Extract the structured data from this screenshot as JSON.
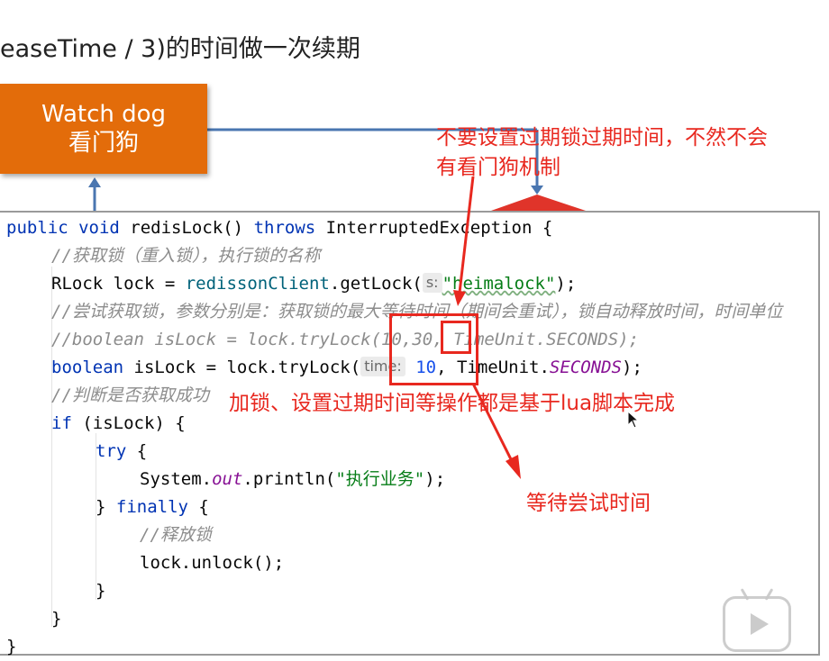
{
  "slide": {
    "title": "easeTime / 3)的时间做一次续期",
    "watchdog_line1": "Watch dog",
    "watchdog_line2": "看门狗"
  },
  "code": {
    "l1_kw1": "public void",
    "l1_method": " redisLock() ",
    "l1_kw2": "throws",
    "l1_rest": " InterruptedException {",
    "l2_comment": "//获取锁（重入锁），执行锁的名称",
    "l3_pre": "RLock lock = ",
    "l3_obj": "redissonClient",
    "l3_mid": ".getLock(",
    "l3_hint": "s:",
    "l3_str": "\"heimalock\"",
    "l3_end": ");",
    "l4_comment": "//尝试获取锁，参数分别是：获取锁的最大等待时间（期间会重试），锁自动释放时间，时间单位",
    "l5_comment": "//boolean isLock = lock.tryLock(10,30, TimeUnit.SECONDS);",
    "l6_kw": "boolean",
    "l6_pre": " isLock = lock.tryLock(",
    "l6_hint": "time:",
    "l6_num": "10",
    "l6_mid": ", TimeUnit.",
    "l6_const": "SECONDS",
    "l6_end": ");",
    "l7_comment": "//判断是否获取成功",
    "l8_kw": "if",
    "l8_rest": " (isLock) {",
    "l9_kw": "try",
    "l9_rest": " {",
    "l10_pre": "System.",
    "l10_field": "out",
    "l10_mid": ".println(",
    "l10_str": "\"执行业务\"",
    "l10_end": ");",
    "l11_pre": "} ",
    "l11_kw": "finally",
    "l11_rest": " {",
    "l12_comment": "//释放锁",
    "l13_text": "lock.unlock();",
    "l14_text": "}",
    "l15_text": "}",
    "l16_text": "}"
  },
  "annotations": {
    "top_line1": "不要设置过期锁过期时间，不然不会",
    "top_line2": "有看门狗机制",
    "middle": "加锁、设置过期时间等操作都是基于lua脚本完成",
    "bottom": "等待尝试时间"
  },
  "colors": {
    "watchdog_bg": "#e36c0a",
    "annotation_red": "#e8281f",
    "keyword_blue": "#0033b3",
    "comment_gray": "#8c8c8c",
    "string_green": "#067d17"
  },
  "icons": {
    "watermark": "play-video-logo-icon",
    "cursor": "mouse-pointer-icon"
  }
}
